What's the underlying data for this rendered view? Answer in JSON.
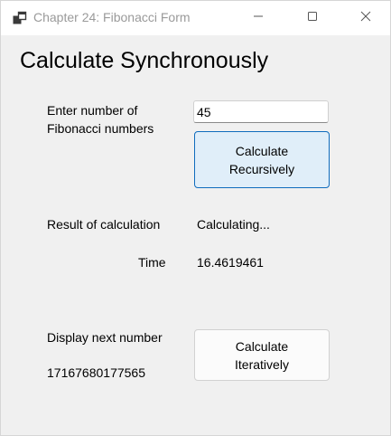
{
  "window": {
    "title": "Chapter 24: Fibonacci Form",
    "icon": "app-window-icon",
    "controls": [
      "minimize-icon",
      "maximize-icon",
      "close-icon"
    ]
  },
  "form": {
    "heading": "Calculate Synchronously",
    "input_label_line1": "Enter number of",
    "input_label_line2": "Fibonacci numbers",
    "input_value": "45",
    "recursive_button_line1": "Calculate",
    "recursive_button_line2": "Recursively",
    "result_label": "Result of calculation",
    "result_value": "Calculating...",
    "time_label": "Time",
    "time_value": "16.4619461",
    "next_label": "Display next number",
    "next_value": "17167680177565",
    "iterative_button_line1": "Calculate",
    "iterative_button_line2": "Iteratively"
  },
  "colors": {
    "accent": "#0f6cbd",
    "focused_button_fill": "#e0eef9",
    "form_background": "#f0f0f0"
  }
}
